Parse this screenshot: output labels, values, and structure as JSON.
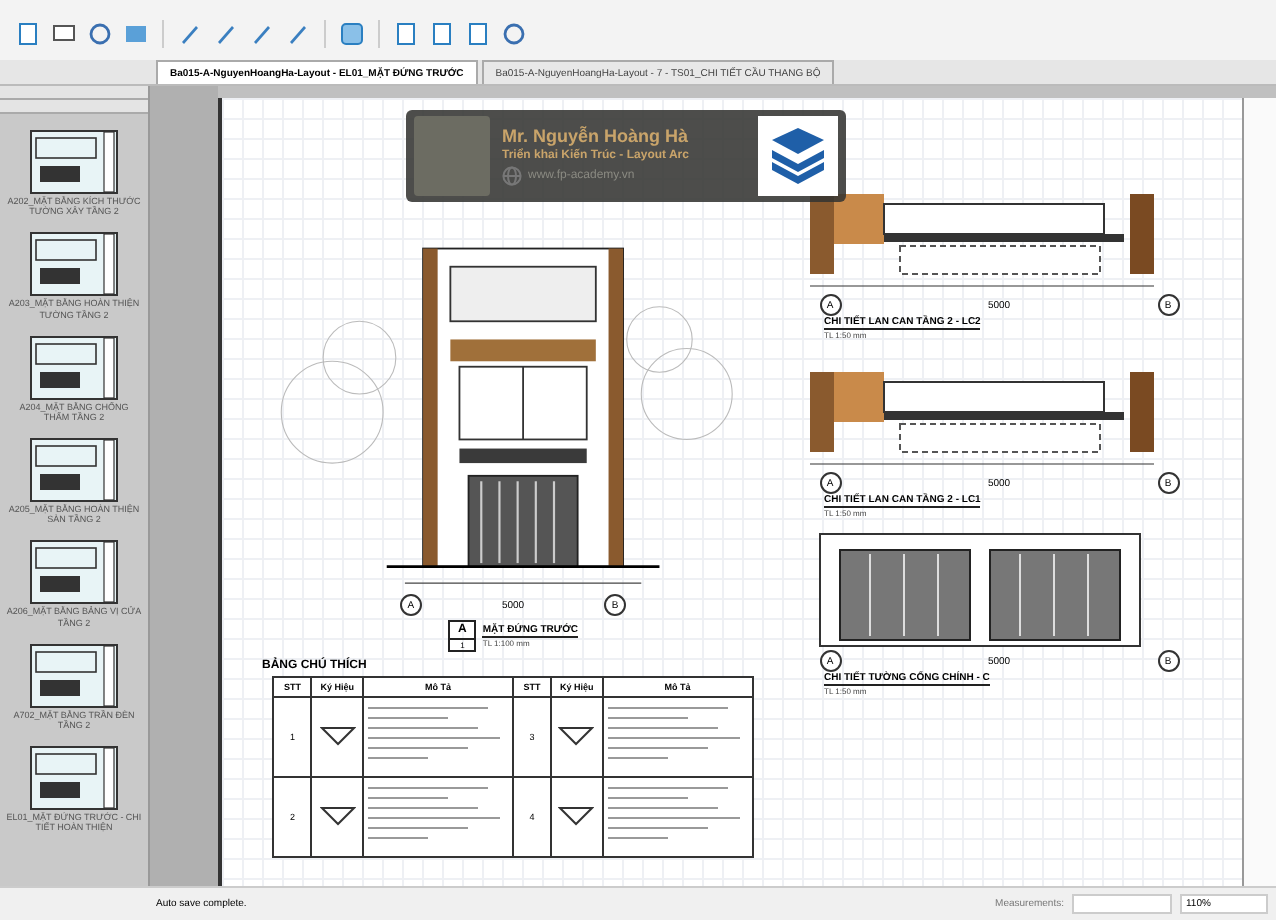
{
  "tabs": [
    {
      "label": "Ba015-A-NguyenHoangHa-Layout - EL01_MẶT ĐỨNG TRƯỚC",
      "selected": true
    },
    {
      "label": "Ba015-A-NguyenHoangHa-Layout - 7 - TS01_CHI TIẾT CẦU THANG BỘ",
      "selected": false
    }
  ],
  "sidebar": {
    "pages": [
      {
        "caption": "A202_MẶT BẰNG KÍCH THƯỚC TƯỜNG XÂY TẦNG 2"
      },
      {
        "caption": "A203_MẶT BẰNG HOÀN THIỆN TƯỜNG TẦNG 2"
      },
      {
        "caption": "A204_MẶT BẰNG CHỐNG THẤM TẦNG 2"
      },
      {
        "caption": "A205_MẶT BẰNG HOÀN THIỆN SÀN TẦNG 2"
      },
      {
        "caption": "A206_MẶT BẰNG BẢNG VỊ CỬA TẦNG 2"
      },
      {
        "caption": "A702_MẶT BẰNG TRẦN ĐÈN TẦNG 2"
      },
      {
        "caption": "EL01_MẶT ĐỨNG TRƯỚC - CHI TIẾT HOÀN THIỆN"
      }
    ]
  },
  "sheet": {
    "elevation": {
      "marker": "A",
      "number": "1",
      "title": "MẶT ĐỨNG TRƯỚC",
      "scale": "TL 1:100 mm",
      "axes": [
        "A",
        "B"
      ],
      "dimension": "5000"
    },
    "details": [
      {
        "title": "CHI TIẾT LAN CAN TẦNG 2 - LC2",
        "scale": "TL 1:50 mm",
        "dimension": "5000",
        "axes": [
          "A",
          "B"
        ]
      },
      {
        "title": "CHI TIẾT LAN CAN TẦNG 2 - LC1",
        "scale": "TL 1:50 mm",
        "dimension": "5000",
        "axes": [
          "A",
          "B"
        ]
      },
      {
        "title": "CHI TIẾT TƯỜNG CỔNG CHÍNH - C",
        "scale": "TL 1:50 mm",
        "dimension": "5000",
        "axes": [
          "A",
          "B"
        ]
      }
    ],
    "legend": {
      "title": "BẢNG CHÚ THÍCH",
      "columns": [
        "STT",
        "Ký Hiệu",
        "Mô Tả",
        "STT",
        "Ký Hiệu",
        "Mô Tả"
      ],
      "rows": [
        {
          "left_no": "1",
          "right_no": "3"
        },
        {
          "left_no": "2",
          "right_no": "4"
        }
      ]
    }
  },
  "overlay": {
    "name": "Mr. Nguyễn Hoàng Hà",
    "subtitle": "Triển khai Kiến Trúc - Layout Arc",
    "website": "www.fp-academy.vn"
  },
  "status_bar": {
    "message": "Auto save complete.",
    "measurements_label": "Measurements:",
    "zoom": "110%"
  }
}
